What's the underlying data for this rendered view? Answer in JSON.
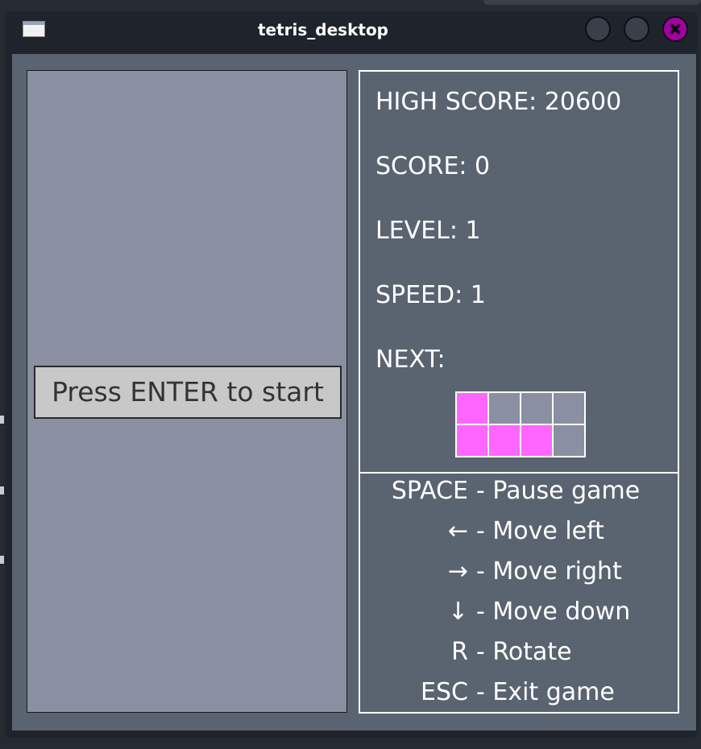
{
  "window": {
    "title": "tetris_desktop"
  },
  "game": {
    "start_prompt": "Press ENTER to start"
  },
  "stats": {
    "high_score": "HIGH SCORE: 20600",
    "score": "SCORE: 0",
    "level": "LEVEL: 1",
    "speed": "SPEED: 1",
    "next_label": "NEXT:"
  },
  "next_piece": {
    "filled_color": "#ff66ff",
    "empty_color": "#8a90a2",
    "grid": [
      [
        1,
        0,
        0,
        0
      ],
      [
        1,
        1,
        1,
        0
      ]
    ]
  },
  "controls": [
    {
      "key": "SPACE",
      "action": "- Pause game"
    },
    {
      "key": "←",
      "action": "- Move left"
    },
    {
      "key": "→",
      "action": "- Move right"
    },
    {
      "key": "↓",
      "action": "- Move down"
    },
    {
      "key": "R",
      "action": "- Rotate"
    },
    {
      "key": "ESC",
      "action": "- Exit game"
    }
  ],
  "colors": {
    "panel_bg": "#5a6470",
    "board_bg": "#8a90a2",
    "titlebar_bg": "#1f232b",
    "close_button": "#a300a3"
  }
}
